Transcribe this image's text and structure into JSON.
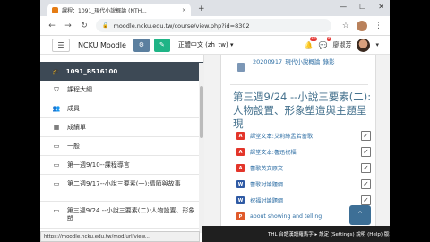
{
  "browser": {
    "tab_title": "課程：1091_現代小說概論 (NTH...",
    "tab_close": "×",
    "new_tab": "+",
    "url": "moodle.ncku.edu.tw/course/view.php?id=8302",
    "status_url": "https://moodle.ncku.edu.tw/mod/url/view..."
  },
  "header": {
    "site_name": "NCKU Moodle",
    "language": "正體中文 (zh_tw)",
    "language_caret": "▾",
    "notification_count": "30",
    "message_count": "4",
    "user_name": "廖淑芳"
  },
  "drawer": {
    "course": "1091_B516100",
    "items": [
      {
        "icon": "shield-icon",
        "glyph": "⛉",
        "label": "課程大綱"
      },
      {
        "icon": "users-icon",
        "glyph": "👥",
        "label": "成員"
      },
      {
        "icon": "grades-icon",
        "glyph": "▦",
        "label": "成績單"
      },
      {
        "icon": "folder-icon",
        "glyph": "▭",
        "label": "一般"
      },
      {
        "icon": "folder-icon",
        "glyph": "▭",
        "label": "第一週9/10--課程導言"
      },
      {
        "icon": "folder-icon",
        "glyph": "▭",
        "label": "第二週9/17--小說三要素(一):情節與故事"
      },
      {
        "icon": "folder-icon",
        "glyph": "▭",
        "label": "第三週9/24 --小說三要素(二):人物設置、形象塑..."
      }
    ]
  },
  "main": {
    "recording_label": "20200917_現代小說概論_錄影",
    "section_title": "第三週9/24 --小說三要素(二):人物設置、形象塑造與主題呈現",
    "activities": [
      {
        "type": "pdf",
        "badge": "A",
        "label": "課堂文本:艾莉絲孟若蕾歌"
      },
      {
        "type": "pdf",
        "badge": "A",
        "label": "課堂文本:魯迅祝福"
      },
      {
        "type": "pdf",
        "badge": "A",
        "label": "蕾歌英文原文"
      },
      {
        "type": "word",
        "badge": "W",
        "label": "蕾歌討論題綱"
      },
      {
        "type": "word",
        "badge": "W",
        "label": "祝福討論題綱"
      },
      {
        "type": "ppt",
        "badge": "P",
        "label": "about showing and telling"
      }
    ]
  },
  "footer": {
    "text": "THL  台語漢語羅馬字 ▸  設定 (Settings)  說明 (Help)  版本 (About)"
  },
  "colors": {
    "course_bar": "#3d4955",
    "section_title": "#46728e",
    "link": "#2c6da3",
    "edit_button": "#1fb486",
    "settings_button": "#5b7f9f"
  }
}
